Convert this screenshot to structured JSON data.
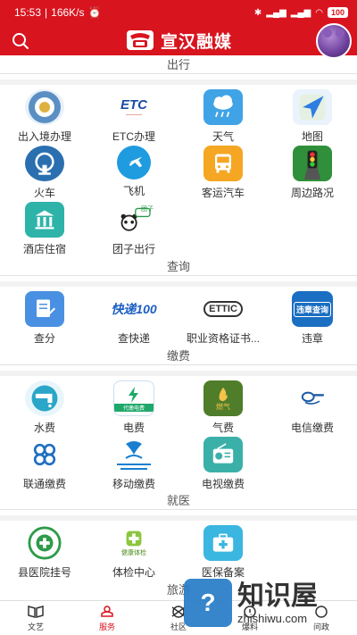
{
  "status": {
    "time": "15:53",
    "speed": "166K/s",
    "battery": "100"
  },
  "header": {
    "title": "宣汉融媒"
  },
  "sections": {
    "travel": {
      "title": "出行",
      "items": [
        "出入境办理",
        "ETC办理",
        "天气",
        "地图",
        "火车",
        "飞机",
        "客运汽车",
        "周边路况",
        "酒店住宿",
        "团子出行"
      ]
    },
    "query": {
      "title": "查询",
      "items": [
        "查分",
        "查快递",
        "职业资格证书...",
        "违章"
      ]
    },
    "pay": {
      "title": "缴费",
      "items": [
        "水费",
        "电费",
        "气费",
        "电信缴费",
        "联通缴费",
        "移动缴费",
        "电视缴费"
      ]
    },
    "medical": {
      "title": "就医",
      "items": [
        "县医院挂号",
        "体检中心",
        "医保备案"
      ]
    },
    "next": {
      "title": "旅游"
    }
  },
  "icon_text": {
    "etc": "ETC",
    "kuaidi": "快递100",
    "ettic": "ETTIC",
    "weizhang": "违章查询",
    "tuanzi": "团子",
    "dianfei": "代缴电费",
    "ranqi": "燃气",
    "tijian": "健康体检"
  },
  "bottom_nav": [
    "文艺",
    "服务",
    "社区",
    "爆料",
    "问政"
  ],
  "watermark": {
    "cn": "知识屋",
    "en": "zhishiwu.com",
    "mark": "?"
  },
  "colors": {
    "brand_red": "#d8141f"
  }
}
